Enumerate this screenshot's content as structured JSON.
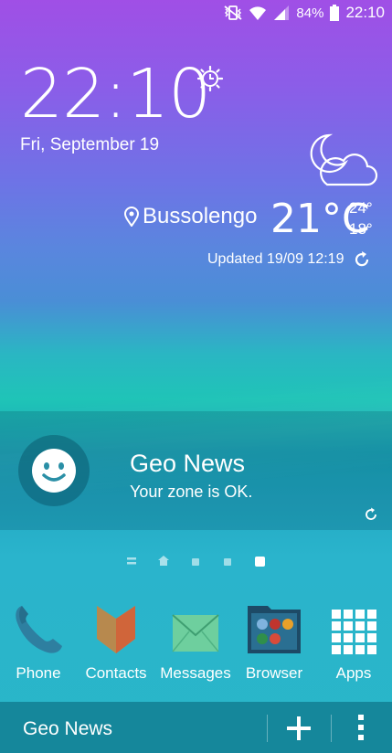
{
  "status_bar": {
    "battery": "84%",
    "time": "22:10"
  },
  "clock": {
    "time": "22:10",
    "date": "Fri, September 19"
  },
  "weather": {
    "location": "Bussolengo",
    "temperature": "21°C",
    "high": "24°",
    "low": "18°",
    "updated": "Updated 19/09 12:19"
  },
  "news_card": {
    "title": "Geo News",
    "subtitle": "Your zone is OK."
  },
  "dock": {
    "apps": [
      {
        "label": "Phone"
      },
      {
        "label": "Contacts"
      },
      {
        "label": "Messages"
      },
      {
        "label": "Browser"
      },
      {
        "label": "Apps"
      }
    ]
  },
  "bottom_bar": {
    "title": "Geo News"
  }
}
